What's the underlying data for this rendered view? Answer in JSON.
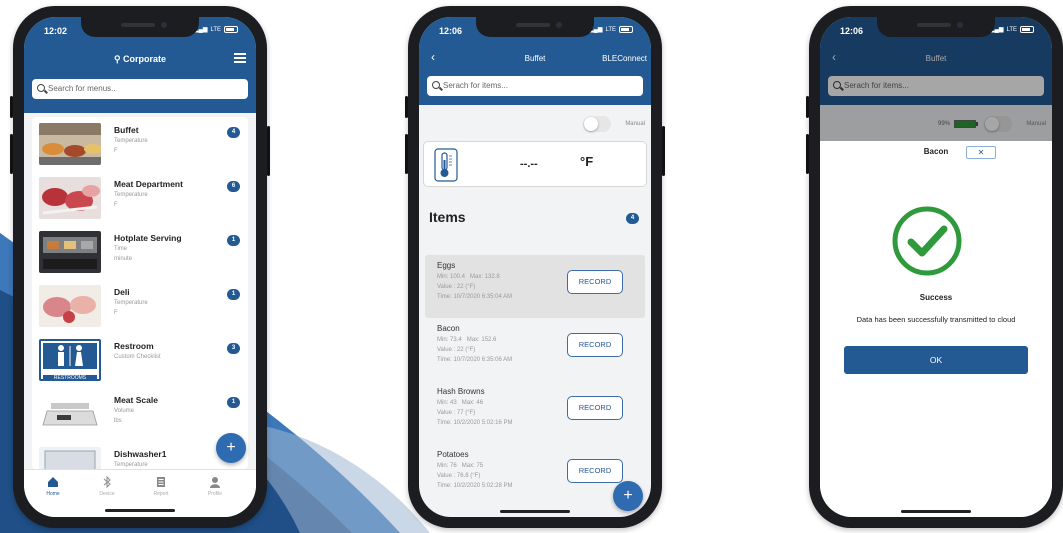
{
  "phone1": {
    "time": "12:02",
    "carrier": "LTE",
    "location": "Corporate",
    "search_placeholder": "Search for menus..",
    "menus": [
      {
        "name": "Buffet",
        "type": "Temperature",
        "unit": "F",
        "count": "4"
      },
      {
        "name": "Meat Department",
        "type": "Temperature",
        "unit": "F",
        "count": "6"
      },
      {
        "name": "Hotplate Serving",
        "type": "Time",
        "unit": "minute",
        "count": "1"
      },
      {
        "name": "Deli",
        "type": "Temperature",
        "unit": "F",
        "count": "1"
      },
      {
        "name": "Restroom",
        "type": "Custom Checklist",
        "unit": "",
        "count": "3"
      },
      {
        "name": "Meat Scale",
        "type": "Volume",
        "unit": "lbs",
        "count": "1"
      },
      {
        "name": "Dishwasher1",
        "type": "Temperature",
        "unit": "C",
        "count": ""
      }
    ],
    "restroom_sign": "RESTROOMS",
    "fab": "+",
    "tabs": [
      "Home",
      "Device",
      "Report",
      "Profile"
    ]
  },
  "phone2": {
    "time": "12:06",
    "carrier": "LTE",
    "title": "Buffet",
    "right_action": "BLEConnect",
    "search_placeholder": "Serach for items...",
    "manual_label": "Manual",
    "reading": "--.--",
    "unit": "°F",
    "items_title": "Items",
    "items_count": "4",
    "items": [
      {
        "name": "Eggs",
        "min": "Min:  100.4",
        "max": "Max:  132.8",
        "value": "Value :  22 (°F)",
        "time": "Time: 10/7/2020 6:35:04 AM",
        "selected": true
      },
      {
        "name": "Bacon",
        "min": "Min:  73.4",
        "max": "Max:  152.6",
        "value": "Value :  22 (°F)",
        "time": "Time: 10/7/2020 6:35:06 AM",
        "selected": false
      },
      {
        "name": "Hash Browns",
        "min": "Min:  43",
        "max": "Max:  46",
        "value": "Value :  77 (°F)",
        "time": "Time: 10/2/2020 5:02:16 PM",
        "selected": false
      },
      {
        "name": "Potatoes",
        "min": "Min:  76",
        "max": "Max:  75",
        "value": "Value :  76.8 (°F)",
        "time": "Time: 10/2/2020 5:02:28 PM",
        "selected": false
      }
    ],
    "record_label": "RECORD",
    "fab": "+"
  },
  "phone3": {
    "time": "12:06",
    "carrier": "LTE",
    "title": "Buffet",
    "search_placeholder": "Serach for items...",
    "battery_pct": "99%",
    "manual_label": "Manual",
    "modal_title": "Bacon",
    "close_label": "✕",
    "success_label": "Success",
    "message": "Data has been successfully transmitted to cloud",
    "ok_label": "OK"
  },
  "colors": {
    "brand_blue": "#245a94",
    "success_green": "#2e9a3c"
  }
}
